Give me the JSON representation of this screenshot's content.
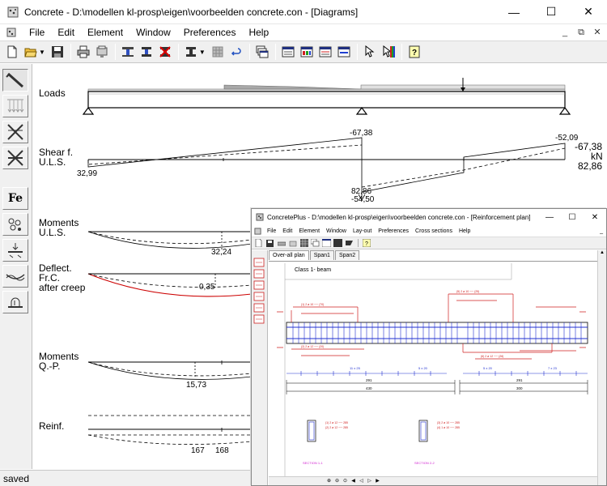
{
  "window": {
    "title": "Concrete - D:\\modellen kl-prosp\\eigen\\voorbeelden concrete.con - [Diagrams]",
    "minimize_glyph": "—",
    "maximize_glyph": "☐",
    "close_glyph": "✕"
  },
  "menu": [
    "File",
    "Edit",
    "Element",
    "Window",
    "Preferences",
    "Help"
  ],
  "mdi_controls": [
    "_",
    "⧉",
    "✕"
  ],
  "left_tools": [
    {
      "icon": "beam-select-icon"
    },
    {
      "icon": "loads-icon"
    },
    {
      "icon": "supports-icon"
    },
    {
      "icon": "cross-support-icon"
    },
    {
      "icon": "reinforcement-fe-icon",
      "label": "Fe"
    },
    {
      "icon": "stirrups-icon"
    },
    {
      "icon": "section-icon"
    },
    {
      "icon": "deflection-icon"
    },
    {
      "icon": "moment-icon"
    }
  ],
  "diagram": {
    "rows": [
      {
        "key": "loads",
        "label_lines": [
          "Loads"
        ]
      },
      {
        "key": "shear",
        "label_lines": [
          "Shear f.",
          "U.L.S."
        ]
      },
      {
        "key": "moments_uls",
        "label_lines": [
          "Moments",
          "U.L.S."
        ]
      },
      {
        "key": "deflect",
        "label_lines": [
          "Deflect.",
          "Fr.C.",
          "after creep"
        ]
      },
      {
        "key": "moments_qp",
        "label_lines": [
          "Moments",
          "Q.-P."
        ]
      },
      {
        "key": "reinf",
        "label_lines": [
          "Reinf."
        ]
      }
    ],
    "values": {
      "shear_left": "32,99",
      "shear_mid_top": "-67,38",
      "shear_mid_bottom_a": "82,86",
      "shear_mid_bottom_b": "-54,50",
      "shear_right_top": "-52,09",
      "moment_uls": "32,24",
      "deflection": "0,35",
      "moment_qp": "15,73",
      "reinf_a": "167",
      "reinf_b": "168"
    },
    "legend": {
      "max": "-67,38",
      "unit": "kN",
      "min": "82,86"
    }
  },
  "status": "saved",
  "overlay": {
    "title": "ConcretePlus - D:\\modellen kl-prosp\\eigen\\voorbeelden concrete.con - [Reinforcement plan]",
    "menu": [
      "File",
      "Edit",
      "Element",
      "Window",
      "Lay-out",
      "Preferences",
      "Cross sections",
      "Help"
    ],
    "tabs": [
      "Over-all plan",
      "Span1",
      "Span2"
    ],
    "drawing_title": "Class 1- beam",
    "dims": {
      "span1": "291",
      "span2": "291",
      "total1": "430",
      "total2": "300"
    },
    "section_a": "SECTION 1-1",
    "section_b": "SECTION 2-2",
    "bars": {
      "a": "11 x 25",
      "b": "5 x 20",
      "c": "5 x 20",
      "d": "7 x 23",
      "e": "(1) 2 ø 10 ── (70)",
      "f": "(2) 2 ø 12 ── (20)",
      "g": "(5) 2 ø 10 ── (25)",
      "h": "(6) 2 ø 12 ── (26)",
      "s1": "(1) 2 ø 12 ── 285",
      "s2": "(2) 2 ø 12 ── 285",
      "s3": "(3) 2 ø 10 ── 285",
      "s4": "(4) 1 ø 10 ── 285"
    }
  }
}
